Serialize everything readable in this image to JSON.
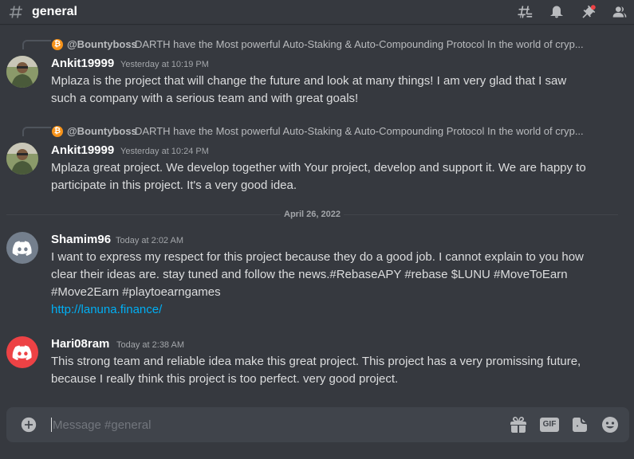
{
  "header": {
    "channel": "general",
    "icons": [
      "threads-icon",
      "notification-bell-icon",
      "pinned-icon",
      "member-list-icon"
    ]
  },
  "messages": [
    {
      "reply": {
        "name": "@Bountyboss",
        "text": "DARTH have the Most powerful Auto-Staking & Auto-Compounding Protocol In the world of cryp..."
      },
      "author": "Ankit19999",
      "timestamp": "Yesterday at 10:19 PM",
      "lines": [
        "Mplaza is the project that will change the future and look at many things! I am very glad that I saw",
        "such a company with a serious team and with great goals!"
      ]
    },
    {
      "reply": {
        "name": "@Bountyboss",
        "text": "DARTH have the Most powerful Auto-Staking & Auto-Compounding Protocol In the world of cryp..."
      },
      "author": "Ankit19999",
      "timestamp": "Yesterday at 10:24 PM",
      "lines": [
        "Mplaza great project. We develop together with Your project, develop and support it. We are happy to",
        "participate in this project. It's a very good idea."
      ]
    },
    {
      "author": "Shamim96",
      "timestamp": "Today at 2:02 AM",
      "lines": [
        "I want to express my respect for this project because they do a good job. I cannot explain to you how",
        "clear their ideas are. stay tuned and follow the news.#RebaseAPY #rebase $LUNU #MoveToEarn",
        "#Move2Earn #playtoearngames"
      ],
      "link": "http://lanuna.finance/"
    },
    {
      "author": "Hari08ram",
      "timestamp": "Today at 2:38 AM",
      "lines": [
        "This strong team and reliable idea make this great project. This project has a very promissing future,",
        "because I really think this project is too perfect. very good project."
      ]
    }
  ],
  "date_divider": "April 26, 2022",
  "composer": {
    "placeholder": "Message #general",
    "value": "",
    "icons": [
      "gift-icon",
      "gif-icon",
      "sticker-icon",
      "emoji-icon"
    ],
    "gif_label": "GIF"
  },
  "colors": {
    "background": "#36393f",
    "composer": "#40444b",
    "link": "#00aff4",
    "discord_gray": "#747f8d",
    "discord_red": "#ed4245",
    "bitcoin_orange": "#f7931a"
  }
}
